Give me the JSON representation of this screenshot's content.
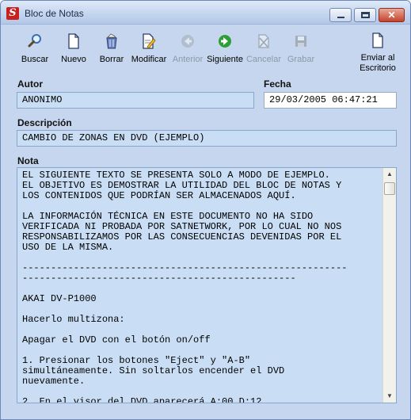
{
  "window": {
    "title": "Bloc de Notas",
    "app_icon_glyph": "S",
    "close_glyph": "✕"
  },
  "toolbar": {
    "buscar": "Buscar",
    "nuevo": "Nuevo",
    "borrar": "Borrar",
    "modificar": "Modificar",
    "anterior": "Anterior",
    "siguiente": "Siguiente",
    "cancelar": "Cancelar",
    "grabar": "Grabar",
    "enviar_line1": "Enviar al",
    "enviar_line2": "Escritorio"
  },
  "form": {
    "autor_label": "Autor",
    "autor_value": "ANONIMO",
    "fecha_label": "Fecha",
    "fecha_value": "29/03/2005 06:47:21",
    "descripcion_label": "Descripción",
    "descripcion_value": "CAMBIO DE ZONAS EN DVD (EJEMPLO)",
    "nota_label": "Nota"
  },
  "note_lines": [
    "EL SIGUIENTE TEXTO SE PRESENTA SOLO A MODO DE EJEMPLO.",
    "EL OBJETIVO ES DEMOSTRAR LA UTILIDAD DEL BLOC DE NOTAS Y",
    "LOS CONTENIDOS QUE PODRÍAN SER ALMACENADOS AQUÍ.",
    "",
    "LA INFORMACIÓN TÉCNICA EN ESTE DOCUMENTO NO HA SIDO",
    "VERIFICADA NI PROBADA POR SATNETWORK, POR LO CUAL NO NOS",
    "RESPONSABILIZAMOS POR LAS CONSECUENCIAS DEVENIDAS POR EL",
    "USO DE LA MISMA.",
    "",
    "---------------------------------------------------------",
    "------------------------------------------------",
    "",
    "AKAI DV-P1000",
    "",
    "Hacerlo multizona:",
    "",
    "Apagar el DVD con el botón on/off",
    "",
    "1. Presionar los botones \"Eject\" y \"A-B\"",
    "simultáneamente. Sin soltarlos encender el DVD",
    "nuevamente.",
    "",
    "2. En el visor del DVD aparecerá A:00 D:12"
  ],
  "icons": {
    "buscar": "magnifier-icon",
    "nuevo": "new-document-icon",
    "borrar": "trash-icon",
    "modificar": "edit-document-icon",
    "anterior": "back-arrow-icon",
    "siguiente": "forward-arrow-icon",
    "cancelar": "cancel-icon",
    "grabar": "save-disk-icon",
    "enviar": "document-icon"
  },
  "colors": {
    "field_background": "#c9def4",
    "window_background": "#c6d6ee",
    "close_button": "#c4432c",
    "forward_arrow": "#2e9e36"
  }
}
